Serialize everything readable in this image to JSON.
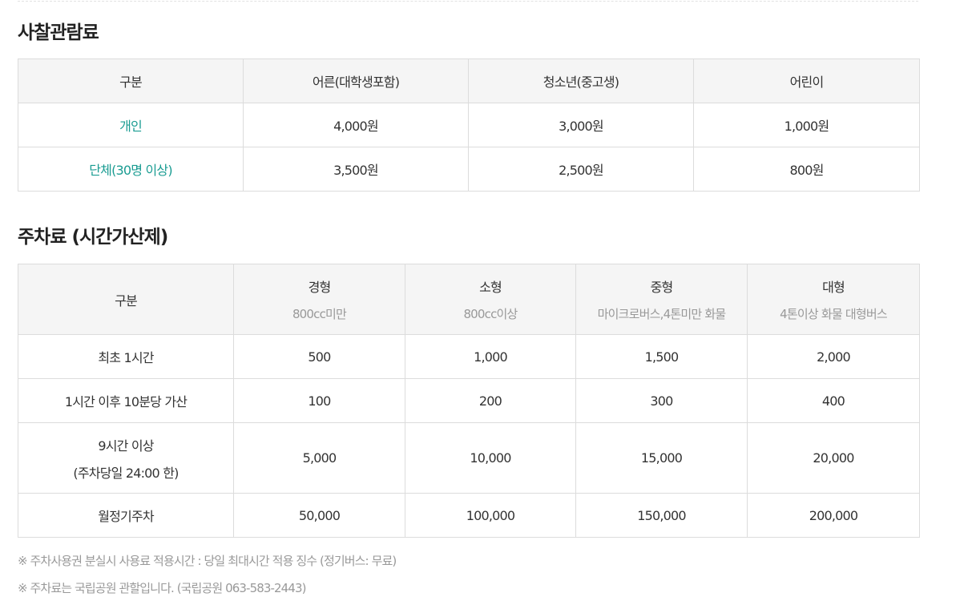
{
  "section1": {
    "title": "사찰관람료",
    "headers": [
      "구분",
      "어른(대학생포함)",
      "청소년(중고생)",
      "어린이"
    ],
    "rows": [
      {
        "label": "개인",
        "adult": "4,000원",
        "youth": "3,000원",
        "child": "1,000원"
      },
      {
        "label": "단체(30명 이상)",
        "adult": "3,500원",
        "youth": "2,500원",
        "child": "800원"
      }
    ]
  },
  "section2": {
    "title": "주차료 (시간가산제)",
    "header_label": "구분",
    "columns": [
      {
        "name": "경형",
        "desc": "800cc미만"
      },
      {
        "name": "소형",
        "desc": "800cc이상"
      },
      {
        "name": "중형",
        "desc": "마이크로버스,4톤미만 화물"
      },
      {
        "name": "대형",
        "desc": "4톤이상 화물 대형버스"
      }
    ],
    "rows": [
      {
        "label": "최초 1시간",
        "values": [
          "500",
          "1,000",
          "1,500",
          "2,000"
        ]
      },
      {
        "label": "1시간 이후 10분당 가산",
        "values": [
          "100",
          "200",
          "300",
          "400"
        ]
      },
      {
        "label": "9시간 이상",
        "label_line2": "(주차당일 24:00 한)",
        "values": [
          "5,000",
          "10,000",
          "15,000",
          "20,000"
        ]
      },
      {
        "label": "월정기주차",
        "values": [
          "50,000",
          "100,000",
          "150,000",
          "200,000"
        ]
      }
    ]
  },
  "notes": [
    "※ 주차사용권 분실시 사용료 적용시간 : 당일 최대시간 적용 징수 (정기버스: 무료)",
    "※ 주차료는 국립공원 관할입니다. (국립공원 063-583-2443)"
  ],
  "colors": {
    "accent": "#1a9c92",
    "header_bg": "#f5f5f5",
    "border": "#dcdcdc",
    "note": "#999999"
  }
}
